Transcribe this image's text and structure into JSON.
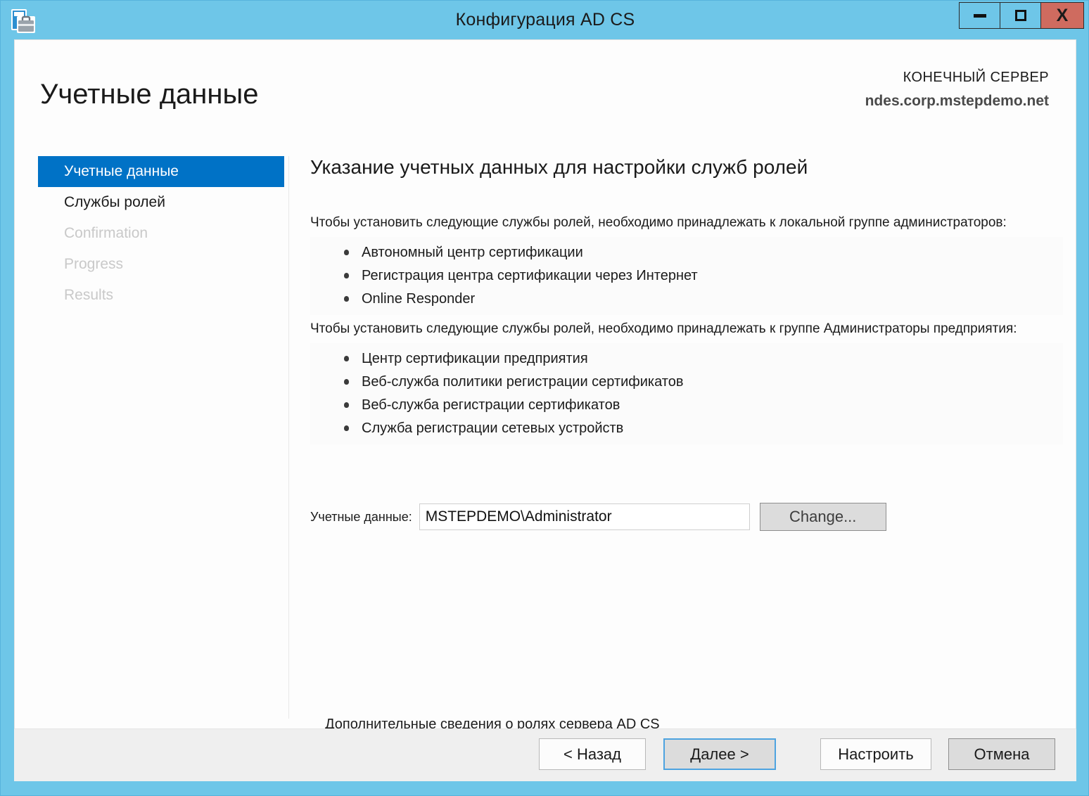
{
  "window": {
    "title": "Конфигурация AD CS",
    "icon": "wizard-toolbox-icon",
    "controls": {
      "minimize": "—",
      "maximize": "□",
      "close": "X"
    },
    "frame_color": "#6ec6e8",
    "close_color": "#cf6b5f"
  },
  "header": {
    "page_title": "Учетные данные",
    "destination_label": "КОНЕЧНЫЙ СЕРВЕР",
    "destination_server": "ndes.corp.mstepdemo.net"
  },
  "sidebar": {
    "items": [
      {
        "label": "Учетные данные",
        "state": "selected"
      },
      {
        "label": "Службы ролей",
        "state": "enabled"
      },
      {
        "label": "Confirmation",
        "state": "disabled"
      },
      {
        "label": "Progress",
        "state": "disabled"
      },
      {
        "label": "Results",
        "state": "disabled"
      }
    ],
    "selected_color": "#0072c6"
  },
  "main": {
    "heading": "Указание учетных данных для настройки служб ролей",
    "paragraph_1": "Чтобы установить следующие службы ролей, необходимо принадлежать к локальной группе администраторов:",
    "list_1": [
      "Автономный центр сертификации",
      "Регистрация центра сертификации через Интернет",
      "Online Responder"
    ],
    "paragraph_2": "Чтобы установить следующие службы ролей, необходимо принадлежать к группе Администраторы предприятия:",
    "list_2": [
      "Центр сертификации предприятия",
      "Веб-служба политики регистрации сертификатов",
      "Веб-служба регистрации сертификатов",
      "Служба регистрации сетевых устройств"
    ],
    "credentials": {
      "label": "Учетные данные:",
      "value": "MSTEPDEMO\\Administrator",
      "placeholder": "",
      "change_button": "Change..."
    },
    "more_info_link": "Дополнительные сведения о ролях сервера AD CS"
  },
  "footer": {
    "back": "< Назад",
    "next": "Далее >",
    "configure": "Настроить",
    "cancel": "Отмена",
    "focus_ring_color": "#4da3e0"
  }
}
